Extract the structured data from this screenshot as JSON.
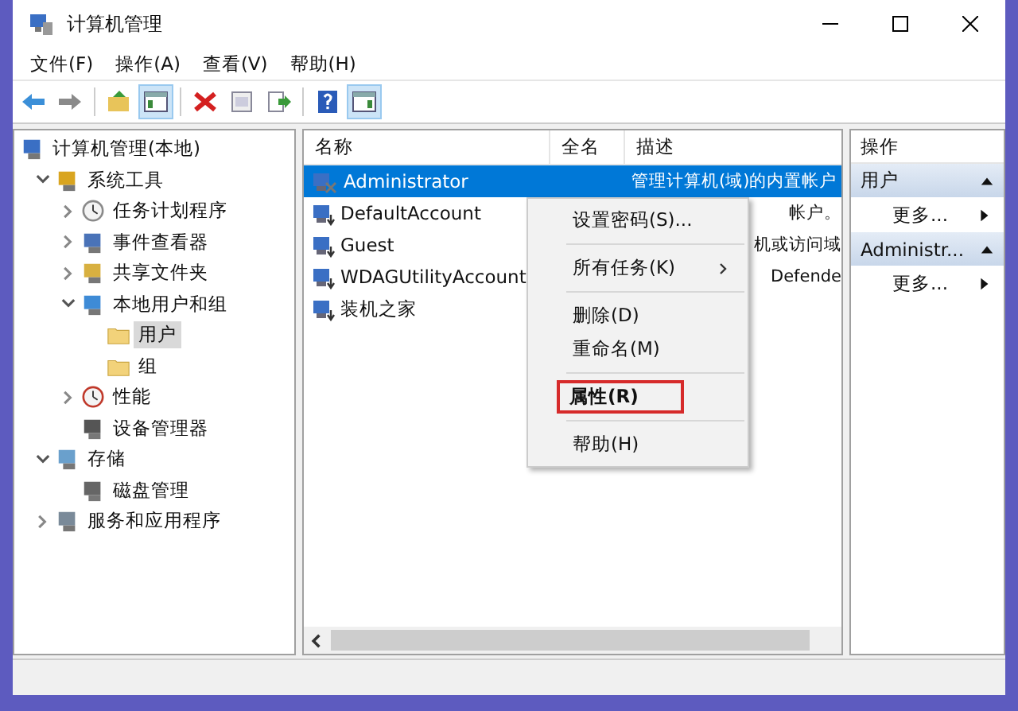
{
  "window": {
    "title": "计算机管理"
  },
  "menu_bar": [
    "文件(F)",
    "操作(A)",
    "查看(V)",
    "帮助(H)"
  ],
  "toolbar": [
    {
      "kind": "back",
      "pressed": false
    },
    {
      "kind": "forward",
      "pressed": false
    },
    {
      "kind": "separator"
    },
    {
      "kind": "up",
      "pressed": false
    },
    {
      "kind": "tree",
      "pressed": true
    },
    {
      "kind": "separator"
    },
    {
      "kind": "delete",
      "pressed": false
    },
    {
      "kind": "properties",
      "pressed": false
    },
    {
      "kind": "export",
      "pressed": false
    },
    {
      "kind": "separator"
    },
    {
      "kind": "help",
      "pressed": false
    },
    {
      "kind": "actionpane",
      "pressed": true
    }
  ],
  "tree": [
    {
      "label": "计算机管理(本地)",
      "selected": false,
      "children": [
        {
          "label": "系统工具",
          "expanded": true,
          "selected": false,
          "children": [
            {
              "label": "任务计划程序",
              "expanded": false,
              "selected": false
            },
            {
              "label": "事件查看器",
              "expanded": false,
              "selected": false
            },
            {
              "label": "共享文件夹",
              "expanded": false,
              "selected": false
            },
            {
              "label": "本地用户和组",
              "expanded": true,
              "selected": false,
              "children": [
                {
                  "label": "用户",
                  "selected": true
                },
                {
                  "label": "组",
                  "selected": false
                }
              ]
            },
            {
              "label": "性能",
              "expanded": false,
              "selected": false
            },
            {
              "label": "设备管理器",
              "selected": false
            }
          ]
        },
        {
          "label": "存储",
          "expanded": true,
          "selected": false,
          "children": [
            {
              "label": "磁盘管理",
              "selected": false
            }
          ]
        },
        {
          "label": "服务和应用程序",
          "expanded": false,
          "selected": false
        }
      ]
    }
  ],
  "table": {
    "columns": [
      "名称",
      "全名",
      "描述"
    ],
    "rows": [
      {
        "name": "Administrator",
        "description": "管理计算机(域)的内置帐户",
        "disabled": true,
        "selected": true
      },
      {
        "name": "DefaultAccount",
        "description": "帐户。",
        "disabled": false,
        "selected": false
      },
      {
        "name": "Guest",
        "description": "机或访问域",
        "disabled": false,
        "selected": false
      },
      {
        "name": "WDAGUtilityAccount",
        "description": "Defende",
        "disabled": false,
        "selected": false
      },
      {
        "name": "装机之家",
        "disabled": false,
        "selected": false
      }
    ]
  },
  "context_menu": [
    {
      "label": "设置密码(S)...",
      "kind": "item",
      "highlighted": false
    },
    {
      "kind": "separator"
    },
    {
      "label": "所有任务(K)",
      "kind": "submenu",
      "highlighted": false
    },
    {
      "kind": "separator"
    },
    {
      "label": "删除(D)",
      "kind": "item",
      "highlighted": false
    },
    {
      "label": "重命名(M)",
      "kind": "item",
      "highlighted": false
    },
    {
      "kind": "separator"
    },
    {
      "label": "属性(R)",
      "kind": "item",
      "highlighted": true
    },
    {
      "kind": "separator"
    },
    {
      "label": "帮助(H)",
      "kind": "item",
      "highlighted": false
    }
  ],
  "actions": {
    "title": "操作",
    "sections": [
      {
        "title": "用户",
        "items": [
          "更多..."
        ]
      },
      {
        "title": "Administr...",
        "items": [
          "更多..."
        ]
      }
    ]
  }
}
